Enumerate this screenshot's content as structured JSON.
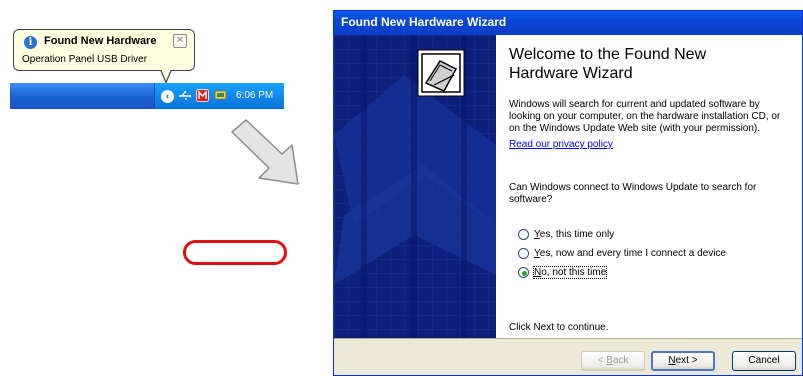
{
  "balloon": {
    "title": "Found New Hardware",
    "body": "Operation Panel USB Driver",
    "close_glyph": "✕"
  },
  "tray": {
    "chevron_glyph": "‹",
    "clock": "6:06 PM",
    "icons": [
      "usb-device-icon",
      "antivirus-icon",
      "network-icon"
    ]
  },
  "wizard": {
    "title": "Found New Hardware Wizard",
    "heading": "Welcome to the Found New Hardware Wizard",
    "intro": "Windows will search for current and updated software by looking on your computer, on the hardware installation CD, or on the Windows Update Web site (with your permission).",
    "privacy_link": "Read our privacy policy",
    "question": "Can Windows connect to Windows Update to search for software?",
    "options": [
      {
        "key": "Y",
        "rest": "es, this time only",
        "selected": false
      },
      {
        "key": "Y",
        "rest": "es, now and every time I connect a device",
        "selected": false
      },
      {
        "key": "N",
        "rest": "o, not this time",
        "selected": true
      }
    ],
    "continue_text": "Click Next to continue.",
    "buttons": {
      "back_key": "B",
      "back_rest": "ack",
      "back_prefix": "< ",
      "next_key": "N",
      "next_rest": "ext >",
      "cancel": "Cancel"
    }
  },
  "colors": {
    "title_bar": "#0a46d6",
    "side_panel": "#0c1f7a",
    "highlight": "#e01010",
    "tray": "#1b5fd6"
  }
}
